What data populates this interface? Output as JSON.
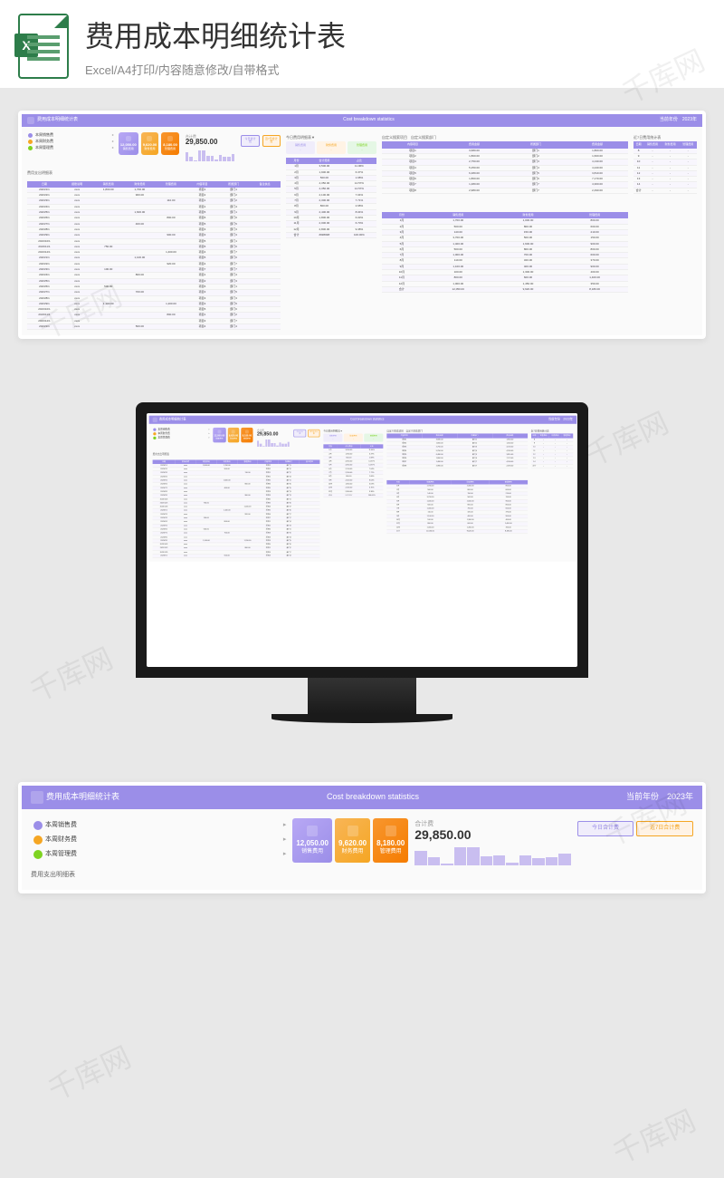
{
  "header": {
    "title": "费用成本明细统计表",
    "subtitle": "Excel/A4打印/内容随意修改/自带格式"
  },
  "watermark": "千库网",
  "dashboard": {
    "title": "费用成本明细统计表",
    "subtitle_en": "Cost breakdown statistics",
    "year_label": "当前年份",
    "year": "2023年",
    "legend": [
      {
        "label": "本周销售费",
        "color": "purple"
      },
      {
        "label": "本周财务费",
        "color": "orange"
      },
      {
        "label": "本周管理费",
        "color": "green"
      }
    ],
    "cards": [
      {
        "value": "12,050.00",
        "label": "销售费用"
      },
      {
        "value": "9,620.00",
        "label": "财务费用"
      },
      {
        "value": "8,180.00",
        "label": "管理费用"
      }
    ],
    "total": {
      "label": "合计费",
      "value": "29,850.00"
    },
    "buttons": [
      "今日合计费",
      "近7日合计费"
    ],
    "detail_section_title": "费用支出明细表",
    "today_section_title": "今日费用明细表▼",
    "sub_cards": [
      {
        "label": "销售费用",
        "value": "-"
      },
      {
        "label": "财务费用",
        "value": "-"
      },
      {
        "label": "管理费用",
        "value": "-"
      }
    ],
    "detail_table": {
      "headers": [
        "日期",
        "报账说明",
        "销售费用",
        "财务费用",
        "管理费用",
        "内容项目",
        "所属部门",
        "备注信息"
      ],
      "rows": [
        [
          "2023/1/1",
          "xxxx",
          "1,800.00",
          "1,700.00",
          "",
          "项目1",
          "部门1",
          ""
        ],
        [
          "2023/2/1",
          "xxxx",
          "",
          "900.00",
          "",
          "项目2",
          "部门2",
          ""
        ],
        [
          "2023/3/1",
          "xxxx",
          "",
          "",
          "110.00",
          "项目1",
          "部门2",
          ""
        ],
        [
          "2023/4/1",
          "xxxx",
          "",
          "",
          "",
          "项目1",
          "部门4",
          ""
        ],
        [
          "2023/5/1",
          "xxxx",
          "",
          "1,600.00",
          "",
          "项目5",
          "部门1",
          ""
        ],
        [
          "2023/6/1",
          "xxxx",
          "",
          "",
          "800.00",
          "项目6",
          "部门6",
          ""
        ],
        [
          "2023/7/1",
          "xxxx",
          "",
          "400.00",
          "",
          "项目5",
          "部门5",
          ""
        ],
        [
          "2023/8/1",
          "xxxx",
          "",
          "",
          "",
          "项目3",
          "部门3",
          ""
        ],
        [
          "2023/9/1",
          "xxxx",
          "",
          "",
          "900.00",
          "项目3",
          "部门3",
          ""
        ],
        [
          "2023/10/1",
          "xxxx",
          "",
          "",
          "",
          "项目5",
          "部门1",
          ""
        ],
        [
          "2023/11/1",
          "xxxx",
          "750.00",
          "",
          "",
          "项目5",
          "部门6",
          ""
        ],
        [
          "2023/12/1",
          "xxxx",
          "",
          "",
          "1,400.00",
          "项目4",
          "部门7",
          ""
        ],
        [
          "2023/1/1",
          "xxxx",
          "",
          "1,100.00",
          "",
          "项目5",
          "部门6",
          ""
        ],
        [
          "2023/2/1",
          "xxxx",
          "",
          "",
          "920.00",
          "项目4",
          "部门7",
          ""
        ],
        [
          "2023/3/1",
          "xxxx",
          "100.00",
          "",
          "",
          "项目7",
          "部门7",
          ""
        ],
        [
          "2023/4/1",
          "xxxx",
          "",
          "800.00",
          "",
          "项目1",
          "部门4",
          ""
        ],
        [
          "2023/5/1",
          "xxxx",
          "",
          "",
          "",
          "项目2",
          "部门3",
          ""
        ],
        [
          "2023/6/1",
          "xxxx",
          "500.00",
          "",
          "",
          "项目6",
          "部门1",
          ""
        ],
        [
          "2023/7/1",
          "xxxx",
          "",
          "700.00",
          "",
          "项目3",
          "部门5",
          ""
        ],
        [
          "2023/8/1",
          "xxxx",
          "",
          "",
          "",
          "项目3",
          "部门3",
          ""
        ],
        [
          "2023/9/1",
          "xxxx",
          "1,100.00",
          "",
          "1,200.00",
          "项目3",
          "部门5",
          ""
        ],
        [
          "2023/10/1",
          "xxxx",
          "",
          "",
          "",
          "项目5",
          "部门6",
          ""
        ],
        [
          "2023/11/1",
          "xxxx",
          "",
          "",
          "800.00",
          "项目1",
          "部门2",
          ""
        ],
        [
          "2023/12/1",
          "xxxx",
          "",
          "",
          "",
          "项目3",
          "部门7",
          ""
        ],
        [
          "2023/1/1",
          "xxxx",
          "",
          "500.00",
          "",
          "项目4",
          "部门4",
          ""
        ]
      ]
    },
    "month_table": {
      "headers": [
        "月份",
        "合计费用",
        "占比"
      ],
      "rows": [
        [
          "1月",
          "3,500.00",
          "11.06%"
        ],
        [
          "2月",
          "1,900.00",
          "6.37%"
        ],
        [
          "3月",
          "500.00",
          "1.68%"
        ],
        [
          "4月",
          "4,350.00",
          "14.57%"
        ],
        [
          "5月",
          "4,350.00",
          "14.57%"
        ],
        [
          "6月",
          "2,100.00",
          "7.04%"
        ],
        [
          "7月",
          "2,300.00",
          "7.71%"
        ],
        [
          "8月",
          "800.00",
          "2.68%"
        ],
        [
          "9月",
          "2,400.00",
          "8.04%"
        ],
        [
          "10月",
          "1,800.00",
          "6.03%"
        ],
        [
          "11月",
          "2,000.00",
          "6.70%"
        ],
        [
          "12月",
          "2,800.00",
          "9.38%"
        ],
        [
          "合计",
          "#######",
          "100.00%"
        ]
      ]
    },
    "project_section": {
      "title1": "自定义搜索项目",
      "title2": "自定义搜索部门",
      "title3": "近7日费用统计表",
      "headers1": [
        "内容项目",
        "费用金额",
        "所属部门",
        "费用金额"
      ],
      "rows1": [
        [
          "项目1",
          "3,680.00",
          "部门1",
          "1,800.00"
        ],
        [
          "项目2",
          "1,800.00",
          "部门2",
          "1,600.00"
        ],
        [
          "项目3",
          "2,750.00",
          "部门3",
          "4,130.00"
        ],
        [
          "项目4",
          "5,250.00",
          "部门4",
          "4,240.00"
        ],
        [
          "项目5",
          "6,480.00",
          "部门5",
          "3,810.00"
        ],
        [
          "项目6",
          "1,860.00",
          "部门6",
          "7,170.00"
        ],
        [
          "项目7",
          "1,480.00",
          "部门7",
          "4,300.00"
        ],
        [
          "项目8",
          "2,980.00",
          "部门7",
          "2,490.00"
        ]
      ],
      "headers2": [
        "日期",
        "销售费用",
        "财务费用",
        "管理费用"
      ],
      "rows2": [
        [
          "8",
          "-",
          "-",
          "-"
        ],
        [
          "9",
          "-",
          "-",
          "-"
        ],
        [
          "10",
          "-",
          "-",
          "-"
        ],
        [
          "11",
          "-",
          "-",
          "-"
        ],
        [
          "12",
          "-",
          "-",
          "-"
        ],
        [
          "13",
          "-",
          "-",
          "-"
        ],
        [
          "14",
          "-",
          "-",
          "-"
        ],
        [
          "合计",
          "-",
          "-",
          "-"
        ]
      ]
    },
    "summary_table": {
      "headers": [
        "月份",
        "销售费用",
        "财务费用",
        "管理费用"
      ],
      "rows": [
        [
          "1月",
          "1,700.00",
          "1,000.00",
          "800.00"
        ],
        [
          "2月",
          "500.00",
          "800.00",
          "600.00"
        ],
        [
          "3月",
          "140.00",
          "150.00",
          "210.00"
        ],
        [
          "4月",
          "3,700.00",
          "500.00",
          "150.00"
        ],
        [
          "5月",
          "1,400.00",
          "1,600.00",
          "900.00"
        ],
        [
          "6月",
          "500.00",
          "800.00",
          "800.00"
        ],
        [
          "7月",
          "1,000.00",
          "700.00",
          "600.00"
        ],
        [
          "8月",
          "110.00",
          "320.00",
          "370.00"
        ],
        [
          "9月",
          "1,100.00",
          "400.00",
          "900.00"
        ],
        [
          "10月",
          "100.00",
          "1,300.00",
          "400.00"
        ],
        [
          "11月",
          "800.00",
          "600.00",
          "1,400.00"
        ],
        [
          "12月",
          "1,000.00",
          "1,450.00",
          "350.00"
        ],
        [
          "合计",
          "12,050.00",
          "9,620.00",
          "8,180.00"
        ]
      ]
    }
  },
  "chart_data": {
    "type": "bar",
    "title": "合计费",
    "categories": [
      "1月",
      "2月",
      "3月",
      "4月",
      "5月",
      "6月",
      "7月",
      "8月",
      "9月",
      "10月",
      "11月",
      "12月"
    ],
    "values": [
      3500,
      1900,
      500,
      4350,
      4350,
      2100,
      2300,
      800,
      2400,
      1800,
      2000,
      2800
    ],
    "total": 29850,
    "ylim": [
      0,
      5000
    ]
  }
}
